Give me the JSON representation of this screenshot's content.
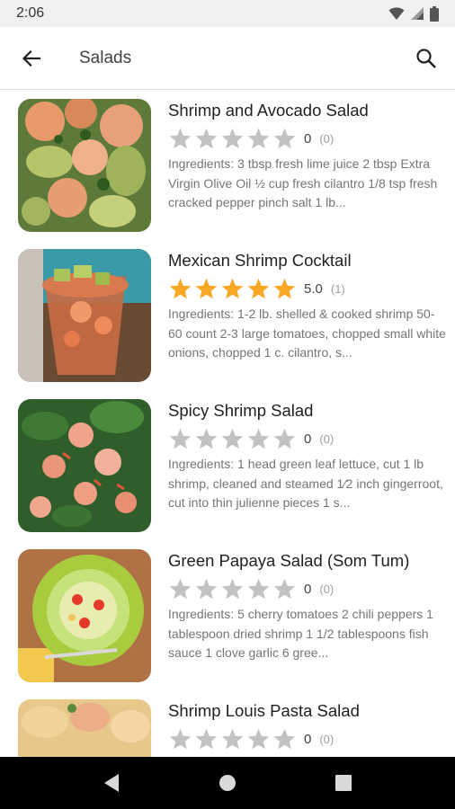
{
  "status_bar": {
    "time": "2:06",
    "icons": [
      "wifi-icon",
      "signal-icon",
      "battery-icon"
    ]
  },
  "app_bar": {
    "title": "Salads",
    "back_icon": "arrow-back-icon",
    "search_icon": "search-icon"
  },
  "colors": {
    "star_filled": "#f9a825",
    "star_empty": "#c2c2c2",
    "text_secondary": "#757575"
  },
  "recipes": [
    {
      "title": "Shrimp and Avocado Salad",
      "stars_filled": 0,
      "rating": "0",
      "count": "(0)",
      "ingredients": "Ingredients: 3 tbsp fresh lime juice 2 tbsp Extra Virgin Olive Oil ½ cup fresh cilantro 1/8 tsp fresh cracked pepper pinch salt 1 lb..."
    },
    {
      "title": "Mexican Shrimp Cocktail",
      "stars_filled": 5,
      "rating": "5.0",
      "count": "(1)",
      "ingredients": "Ingredients: 1-2 lb. shelled & cooked shrimp 50-60 count 2-3 large tomatoes, chopped small white onions, chopped 1 c. cilantro, s..."
    },
    {
      "title": "Spicy Shrimp Salad",
      "stars_filled": 0,
      "rating": "0",
      "count": "(0)",
      "ingredients": "Ingredients: 1 head green leaf lettuce, cut 1 lb shrimp, cleaned and steamed 1⁄2 inch gingerroot, cut into thin julienne pieces 1 s..."
    },
    {
      "title": "Green Papaya Salad (Som Tum)",
      "stars_filled": 0,
      "rating": "0",
      "count": "(0)",
      "ingredients": "Ingredients: 5 cherry tomatoes 2 chili peppers 1 tablespoon dried shrimp 1 1/2 tablespoons fish sauce 1 clove garlic 6 gree..."
    },
    {
      "title": "Shrimp Louis Pasta Salad",
      "stars_filled": 0,
      "rating": "0",
      "count": "(0)",
      "ingredients": ""
    }
  ],
  "nav_bar": {
    "back": "nav-back-icon",
    "home": "nav-home-icon",
    "recents": "nav-recents-icon"
  }
}
